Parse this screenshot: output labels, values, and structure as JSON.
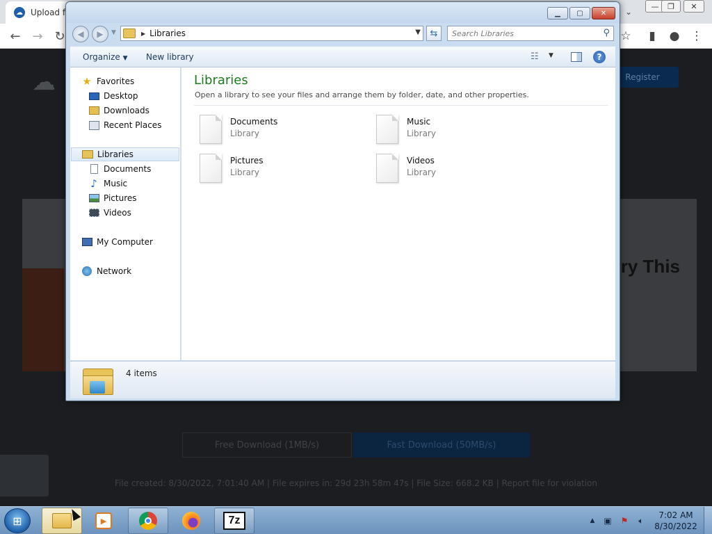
{
  "browser": {
    "tab_title": "Upload fi",
    "tab_favicon": "cloud-logo-icon",
    "nav_icons": [
      "back-arrow-icon",
      "forward-arrow-icon",
      "reload-icon"
    ],
    "right_icons": [
      "bookmark-star-icon",
      "side-panel-icon",
      "profile-icon",
      "menu-kebab-icon"
    ],
    "page": {
      "register_label": "Register",
      "promo_text": "ry This",
      "free_download": "Free Download (1MB/s)",
      "fast_download": "Fast Download (50MB/s)",
      "file_info": "File created: 8/30/2022, 7:01:40 AM  |  File expires in: 29d 23h 58m 47s  |  File Size: 668.2 KB  |  Report file for violation"
    }
  },
  "explorer": {
    "address": "Libraries",
    "search_placeholder": "Search Libraries",
    "commands": {
      "organize": "Organize",
      "new_library": "New library"
    },
    "nav": {
      "favorites": {
        "label": "Favorites",
        "items": [
          "Desktop",
          "Downloads",
          "Recent Places"
        ]
      },
      "libraries": {
        "label": "Libraries",
        "items": [
          "Documents",
          "Music",
          "Pictures",
          "Videos"
        ]
      },
      "computer": "My Computer",
      "network": "Network"
    },
    "content": {
      "title": "Libraries",
      "description": "Open a library to see your files and arrange them by folder, date, and other properties.",
      "items": [
        {
          "name": "Documents",
          "type": "Library"
        },
        {
          "name": "Music",
          "type": "Library"
        },
        {
          "name": "Pictures",
          "type": "Library"
        },
        {
          "name": "Videos",
          "type": "Library"
        }
      ]
    },
    "status": {
      "count": "4 items"
    }
  },
  "taskbar": {
    "apps": [
      "windows-explorer",
      "media-player",
      "google-chrome",
      "firefox",
      "7-zip"
    ],
    "seven_zip_label": "7z",
    "clock": {
      "time": "7:02 AM",
      "date": "8/30/2022"
    }
  },
  "colors": {
    "explorer_frame": "#c9dcf0",
    "library_title": "#1e7a1e",
    "taskbar": "#7ba0c8"
  }
}
